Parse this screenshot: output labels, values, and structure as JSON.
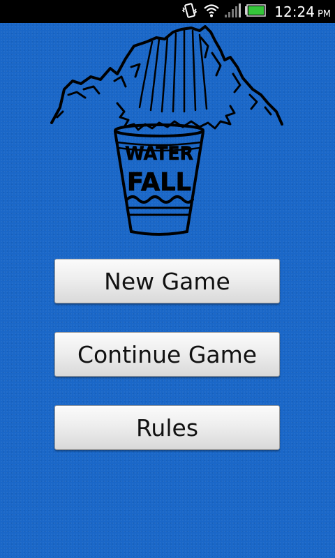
{
  "status_bar": {
    "time": "12:24",
    "ampm": "PM",
    "icons": [
      "vibrate-icon",
      "wifi-icon",
      "signal-icon",
      "battery-icon"
    ]
  },
  "logo": {
    "line1": "WATER",
    "line2": "FALL"
  },
  "menu": {
    "new_game": "New Game",
    "continue_game": "Continue Game",
    "rules": "Rules"
  },
  "colors": {
    "background": "#1a67c8",
    "button": "#eeeeee",
    "battery": "#35c63a"
  }
}
